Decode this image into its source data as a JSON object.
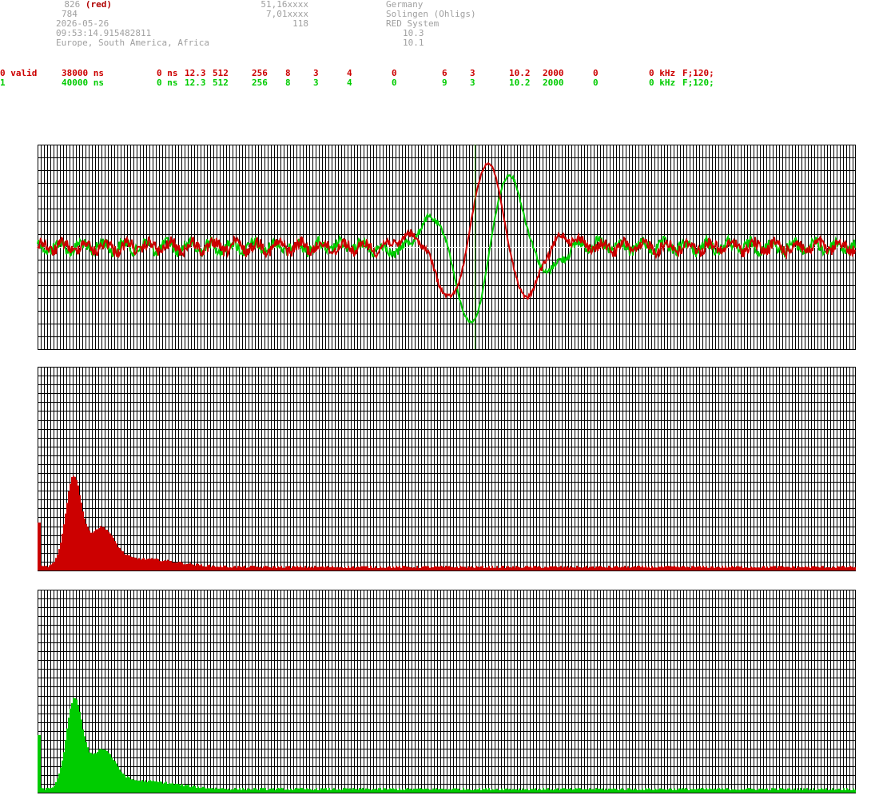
{
  "header": {
    "col1": {
      "line1": "826",
      "line1_tag": "(red)",
      "line2": "784",
      "line3": "2026-05-26",
      "line4": "09:53:14.915482811",
      "line5": "Europe, South America, Africa"
    },
    "col2": {
      "line1": "51,16xxxx",
      "line2": "7,01xxxx",
      "line3": "118"
    },
    "col3": {
      "line1": "Germany",
      "line2": "Solingen (Ohligs)",
      "line3": "RED System",
      "line4": "10.3",
      "line5": "10.1"
    }
  },
  "channels": [
    {
      "id": "0 valid",
      "time": "38000 ns",
      "offset": "0 ns",
      "v1": "12.3",
      "v2": "512",
      "v3": "256",
      "v4": "8",
      "v5": "3",
      "v6": "4",
      "v7": "0",
      "v8": "6",
      "v9": "3",
      "v10": "10.2",
      "v11": "2000",
      "v12": "0",
      "freq": "0 kHz",
      "filter": "F;120;",
      "color": "#cc0000"
    },
    {
      "id": "1",
      "time": "40000 ns",
      "offset": "0 ns",
      "v1": "12.3",
      "v2": "512",
      "v3": "256",
      "v4": "8",
      "v5": "3",
      "v6": "4",
      "v7": "0",
      "v8": "9",
      "v9": "3",
      "v10": "10.2",
      "v11": "2000",
      "v12": "0",
      "freq": "0 kHz",
      "filter": "F;120;",
      "color": "#00cc00"
    }
  ],
  "colors": {
    "red": "#cc0000",
    "green": "#00cc00",
    "grid": "#000000",
    "header_text": "#a0a0a0",
    "marker": "#44aa00"
  },
  "waveform": {
    "marker_fraction": 0.535
  }
}
